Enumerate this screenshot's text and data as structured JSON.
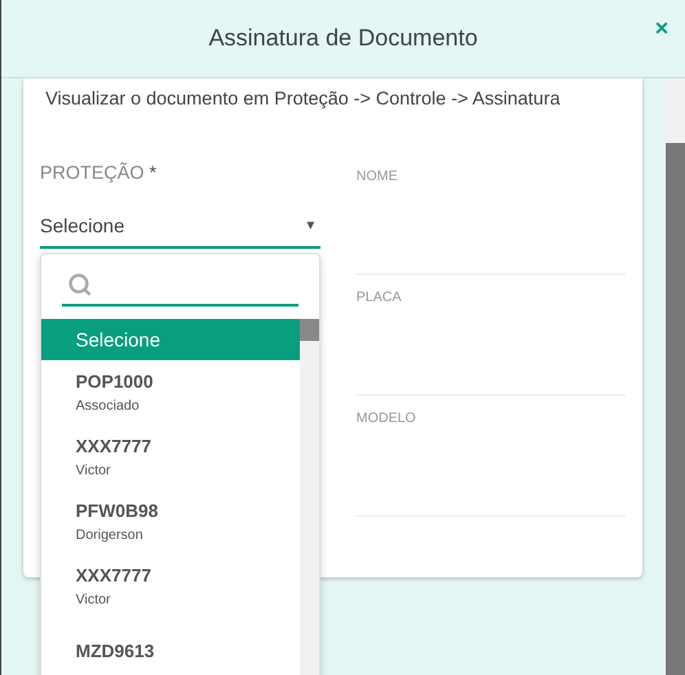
{
  "window": {
    "title": "Assinatura de Documento",
    "close": "×"
  },
  "instruction": "Visualizar o documento em Proteção -> Controle -> Assinatura",
  "protecao_field": {
    "label": "PROTEÇÃO",
    "required_mark": "*",
    "value": "Selecione",
    "caret": "▾",
    "expanded": true
  },
  "info_fields": [
    {
      "label": "NOME"
    },
    {
      "label": "PLACA"
    },
    {
      "label": "MODELO"
    }
  ],
  "dropdown": {
    "options": [
      {
        "title": "Selecione",
        "selected": true
      },
      {
        "title": "POP1000",
        "subtitle": "Associado",
        "selected": false
      },
      {
        "title": "XXX7777",
        "subtitle": "Victor",
        "selected": false
      },
      {
        "title": "PFW0B98",
        "subtitle": "Dorigerson",
        "selected": false
      },
      {
        "title": "XXX7777",
        "subtitle": "Victor",
        "selected": false
      },
      {
        "title": "MZD9613",
        "selected": false
      }
    ]
  }
}
